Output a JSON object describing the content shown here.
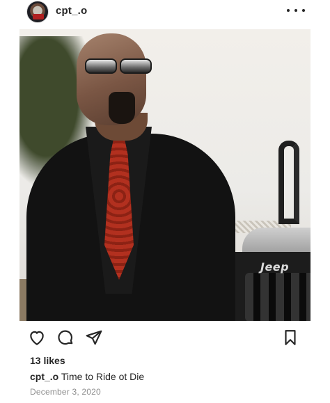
{
  "post": {
    "username": "cpt_.o",
    "likes": "13 likes",
    "caption_user": "cpt_.o",
    "caption_text": " Time to Ride ot Die",
    "date": "December 3, 2020",
    "photo_text": "Jeep"
  },
  "icons": {
    "avatar": "profile-avatar",
    "more": "more-horizontal-icon",
    "like": "heart-icon",
    "comment": "comment-icon",
    "share": "send-icon",
    "save": "bookmark-icon"
  },
  "colors": {
    "text": "#262626",
    "muted": "#8e8e8e",
    "background": "#ffffff"
  }
}
